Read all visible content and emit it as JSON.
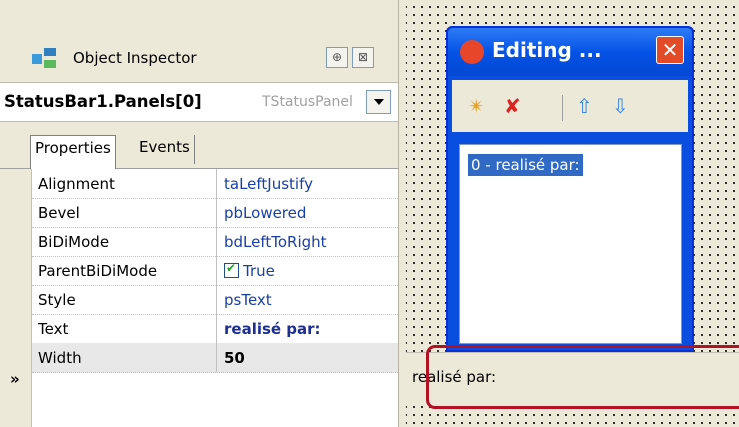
{
  "inspector": {
    "title": "Object Inspector",
    "object_name": "StatusBar1.Panels[0]",
    "object_type": "TStatusPanel",
    "tabs": [
      {
        "label": "Properties"
      },
      {
        "label": "Events"
      }
    ],
    "pin_glyph": "⊕",
    "close_glyph": "⊠",
    "properties": [
      {
        "name": "Alignment",
        "value": "taLeftJustify"
      },
      {
        "name": "Bevel",
        "value": "pbLowered"
      },
      {
        "name": "BiDiMode",
        "value": "bdLeftToRight"
      },
      {
        "name": "ParentBiDiMode",
        "value": "True"
      },
      {
        "name": "Style",
        "value": "psText"
      },
      {
        "name": "Text",
        "value": "realisé par:"
      },
      {
        "name": "Width",
        "value": "50"
      }
    ],
    "selected_marker": "»"
  },
  "editor": {
    "title": "Editing ...",
    "close_glyph": "✕",
    "toolbar": [
      {
        "icon": "add-new-icon",
        "glyph": "✴"
      },
      {
        "icon": "delete-icon",
        "glyph": "✘"
      },
      {
        "icon": "move-up-icon",
        "glyph": "⇧"
      },
      {
        "icon": "move-down-icon",
        "glyph": "⇩"
      }
    ],
    "list_items": [
      "0 - realisé par:"
    ]
  },
  "statusbar": {
    "text": "realisé par:"
  },
  "colors": {
    "xp_title_blue": "#0553e6",
    "selection": "#316ac5",
    "highlight_red": "#b31224",
    "value_blue": "#1a3fa3"
  }
}
